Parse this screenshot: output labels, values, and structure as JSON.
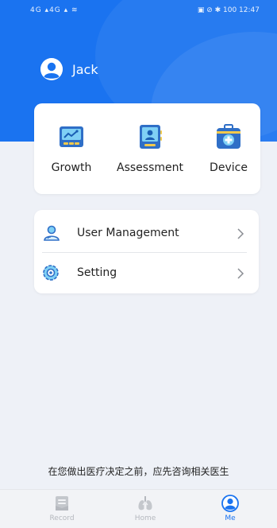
{
  "status_bar": {
    "left": "4G ▴4G ▴ ≋",
    "right": "▣ ⊘ ✱ 100 12:47"
  },
  "user": {
    "name": "Jack"
  },
  "features": [
    {
      "label": "Growth",
      "icon": "growth-chart-icon"
    },
    {
      "label": "Assessment",
      "icon": "assessment-tablet-icon"
    },
    {
      "label": "Device",
      "icon": "device-kit-icon"
    }
  ],
  "menu": [
    {
      "label": "User Management",
      "icon": "user-management-icon"
    },
    {
      "label": "Setting",
      "icon": "setting-gear-icon"
    }
  ],
  "disclaimer": "在您做出医疗决定之前，应先咨询相关医生",
  "tabs": [
    {
      "label": "Record",
      "icon": "record-icon",
      "active": false
    },
    {
      "label": "Home",
      "icon": "lungs-icon",
      "active": false
    },
    {
      "label": "Me",
      "icon": "me-icon",
      "active": true
    }
  ],
  "colors": {
    "primary": "#1a73f0",
    "background": "#eef1f7",
    "inactive_tab": "#b5b8be"
  }
}
